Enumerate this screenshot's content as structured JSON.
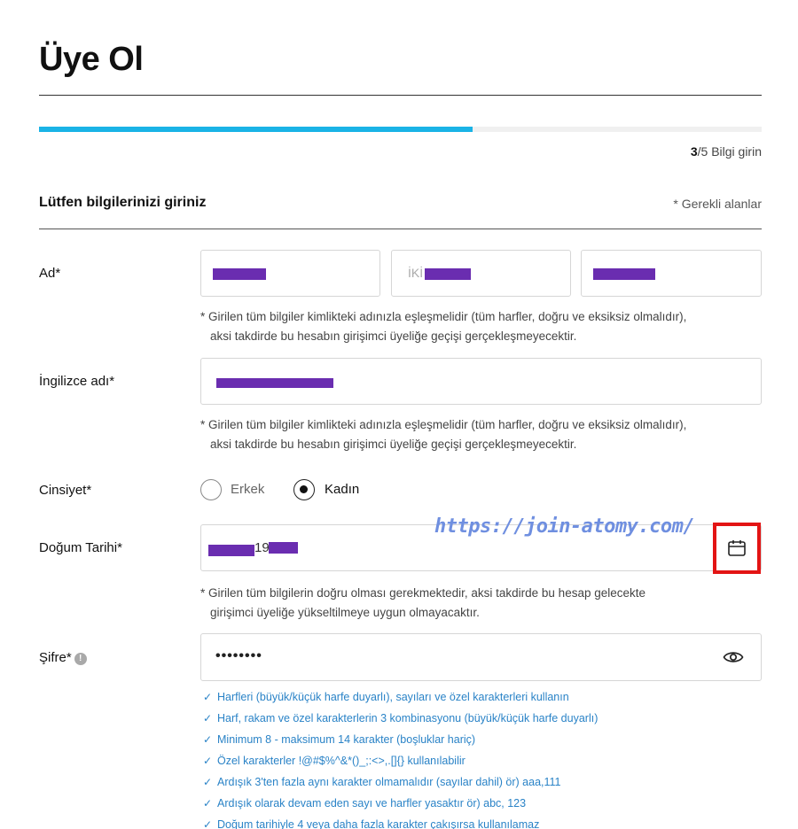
{
  "header": {
    "title": "Üye Ol"
  },
  "progress": {
    "step_current": "3",
    "step_rest": "/5 Bilgi girin",
    "fraction": 0.6,
    "fill_color": "#1ab3e6"
  },
  "section": {
    "title": "Lütfen bilgilerinizi giriniz",
    "required_note": "* Gerekli alanlar"
  },
  "name": {
    "label": "Ad*",
    "field2_prefix": "İKİ",
    "note_line1": "* Girilen tüm bilgiler kimlikteki adınızla eşleşmelidir (tüm harfler, doğru ve eksiksiz olmalıdır),",
    "note_line2": "aksi takdirde bu hesabın girişimci üyeliğe geçişi gerçekleşmeyecektir."
  },
  "english_name": {
    "label": "İngilizce adı*",
    "note_line1": "* Girilen tüm bilgiler kimlikteki adınızla eşleşmelidir (tüm harfler, doğru ve eksiksiz olmalıdır),",
    "note_line2": "aksi takdirde bu hesabın girişimci üyeliğe geçişi gerçekleşmeyecektir."
  },
  "gender": {
    "label": "Cinsiyet*",
    "options": [
      "Erkek",
      "Kadın"
    ],
    "selected": "Kadın"
  },
  "birth": {
    "label": "Doğum Tarihi*",
    "value_visible": "19",
    "note_line1": "* Girilen tüm bilgilerin doğru olması gerekmektedir, aksi takdirde bu hesap gelecekte",
    "note_line2": "girişimci üyeliğe yükseltilmeye uygun olmayacaktır."
  },
  "watermark": "https://join-atomy.com/",
  "password": {
    "label": "Şifre*",
    "info_glyph": "!",
    "masked_value": "••••••••",
    "rules": [
      "Harfleri (büyük/küçük harfe duyarlı), sayıları ve özel karakterleri kullanın",
      "Harf, rakam ve özel karakterlerin 3 kombinasyonu (büyük/küçük harfe duyarlı)",
      "Minimum 8 - maksimum 14 karakter (boşluklar hariç)",
      "Özel karakterler !@#$%^&*()_;:<>,.[]{} kullanılabilir",
      "Ardışık 3'ten fazla aynı karakter olmamalıdır (sayılar dahil) ör) aaa,111",
      "Ardışık olarak devam eden sayı ve harfler yasaktır ör) abc, 123",
      "Doğum tarihiyle 4 veya daha fazla karakter çakışırsa kullanılamaz"
    ]
  },
  "icons": {
    "calendar": "calendar-icon",
    "eye": "eye-icon",
    "check": "check-icon",
    "info": "info-icon"
  },
  "colors": {
    "accent": "#1ab3e6",
    "rule_text": "#2a83c7",
    "redaction": "#6a2db0",
    "highlight": "#e31414"
  }
}
